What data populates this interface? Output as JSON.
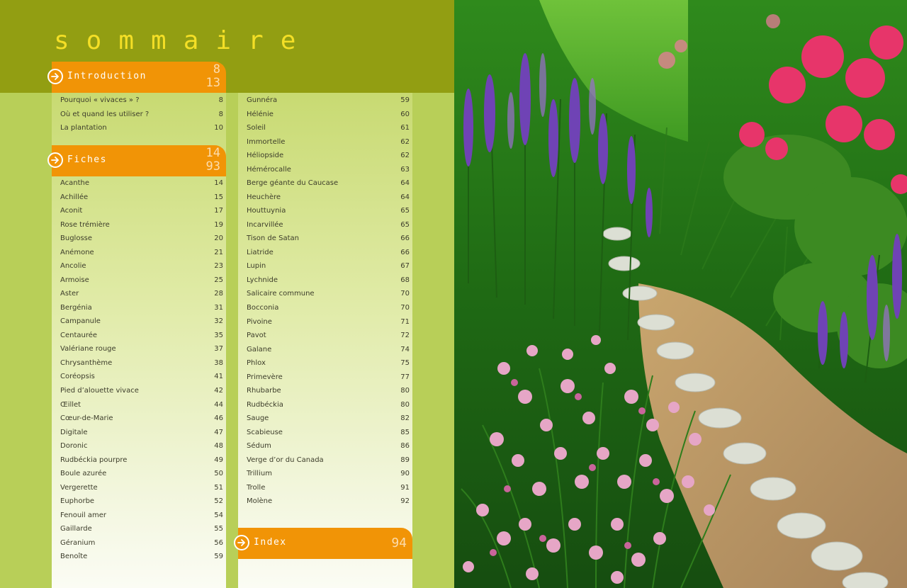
{
  "title": "sommaire",
  "sections": {
    "intro": {
      "label": "Introduction",
      "page_start": "8",
      "page_end": "13"
    },
    "fiches": {
      "label": "Fiches",
      "page_start": "14",
      "page_end": "93"
    },
    "index": {
      "label": "Index",
      "page": "94"
    }
  },
  "intro_items": [
    {
      "name": "Pourquoi « vivaces » ?",
      "page": "8"
    },
    {
      "name": "Où et quand les utiliser ?",
      "page": "8"
    },
    {
      "name": "La plantation",
      "page": "10"
    }
  ],
  "fiches_col1": [
    {
      "name": "Acanthe",
      "page": "14"
    },
    {
      "name": "Achillée",
      "page": "15"
    },
    {
      "name": "Aconit",
      "page": "17"
    },
    {
      "name": "Rose trémière",
      "page": "19"
    },
    {
      "name": "Buglosse",
      "page": "20"
    },
    {
      "name": "Anémone",
      "page": "21"
    },
    {
      "name": "Ancolie",
      "page": "23"
    },
    {
      "name": "Armoise",
      "page": "25"
    },
    {
      "name": "Aster",
      "page": "28"
    },
    {
      "name": "Bergénia",
      "page": "31"
    },
    {
      "name": "Campanule",
      "page": "32"
    },
    {
      "name": "Centaurée",
      "page": "35"
    },
    {
      "name": "Valériane rouge",
      "page": "37"
    },
    {
      "name": "Chrysanthème",
      "page": "38"
    },
    {
      "name": "Coréopsis",
      "page": "41"
    },
    {
      "name": "Pied d’alouette vivace",
      "page": "42"
    },
    {
      "name": "Œillet",
      "page": "44"
    },
    {
      "name": "Cœur-de-Marie",
      "page": "46"
    },
    {
      "name": "Digitale",
      "page": "47"
    },
    {
      "name": "Doronic",
      "page": "48"
    },
    {
      "name": "Rudbéckia pourpre",
      "page": "49"
    },
    {
      "name": "Boule azurée",
      "page": "50"
    },
    {
      "name": "Vergerette",
      "page": "51"
    },
    {
      "name": "Euphorbe",
      "page": "52"
    },
    {
      "name": "Fenouil amer",
      "page": "54"
    },
    {
      "name": "Gaillarde",
      "page": "55"
    },
    {
      "name": "Géranium",
      "page": "56"
    },
    {
      "name": "Benoîte",
      "page": "59"
    }
  ],
  "fiches_col2": [
    {
      "name": "Gunnéra",
      "page": "59"
    },
    {
      "name": "Hélénie",
      "page": "60"
    },
    {
      "name": "Soleil",
      "page": "61"
    },
    {
      "name": "Immortelle",
      "page": "62"
    },
    {
      "name": "Héliopside",
      "page": "62"
    },
    {
      "name": "Hémérocalle",
      "page": "63"
    },
    {
      "name": "Berge géante du Caucase",
      "page": "64"
    },
    {
      "name": "Heuchère",
      "page": "64"
    },
    {
      "name": "Houttuynia",
      "page": "65"
    },
    {
      "name": "Incarvillée",
      "page": "65"
    },
    {
      "name": "Tison de Satan",
      "page": "66"
    },
    {
      "name": "Liatride",
      "page": "66"
    },
    {
      "name": "Lupin",
      "page": "67"
    },
    {
      "name": "Lychnide",
      "page": "68"
    },
    {
      "name": "Salicaire commune",
      "page": "70"
    },
    {
      "name": "Bocconia",
      "page": "70"
    },
    {
      "name": "Pivoine",
      "page": "71"
    },
    {
      "name": "Pavot",
      "page": "72"
    },
    {
      "name": "Galane",
      "page": "74"
    },
    {
      "name": "Phlox",
      "page": "75"
    },
    {
      "name": "Primevère",
      "page": "77"
    },
    {
      "name": "Rhubarbe",
      "page": "80"
    },
    {
      "name": "Rudbéckia",
      "page": "80"
    },
    {
      "name": "Sauge",
      "page": "82"
    },
    {
      "name": "Scabieuse",
      "page": "85"
    },
    {
      "name": "Sédum",
      "page": "86"
    },
    {
      "name": "Verge d’or du Canada",
      "page": "89"
    },
    {
      "name": "Trillium",
      "page": "90"
    },
    {
      "name": "Trolle",
      "page": "91"
    },
    {
      "name": "Molène",
      "page": "92"
    }
  ],
  "colors": {
    "olive_band": "#929e12",
    "page_green": "#b8cf58",
    "title_yellow": "#f4df26",
    "accent_orange": "#f19406",
    "page_number_peach": "#fcdcad",
    "text": "#3d3d2b"
  }
}
